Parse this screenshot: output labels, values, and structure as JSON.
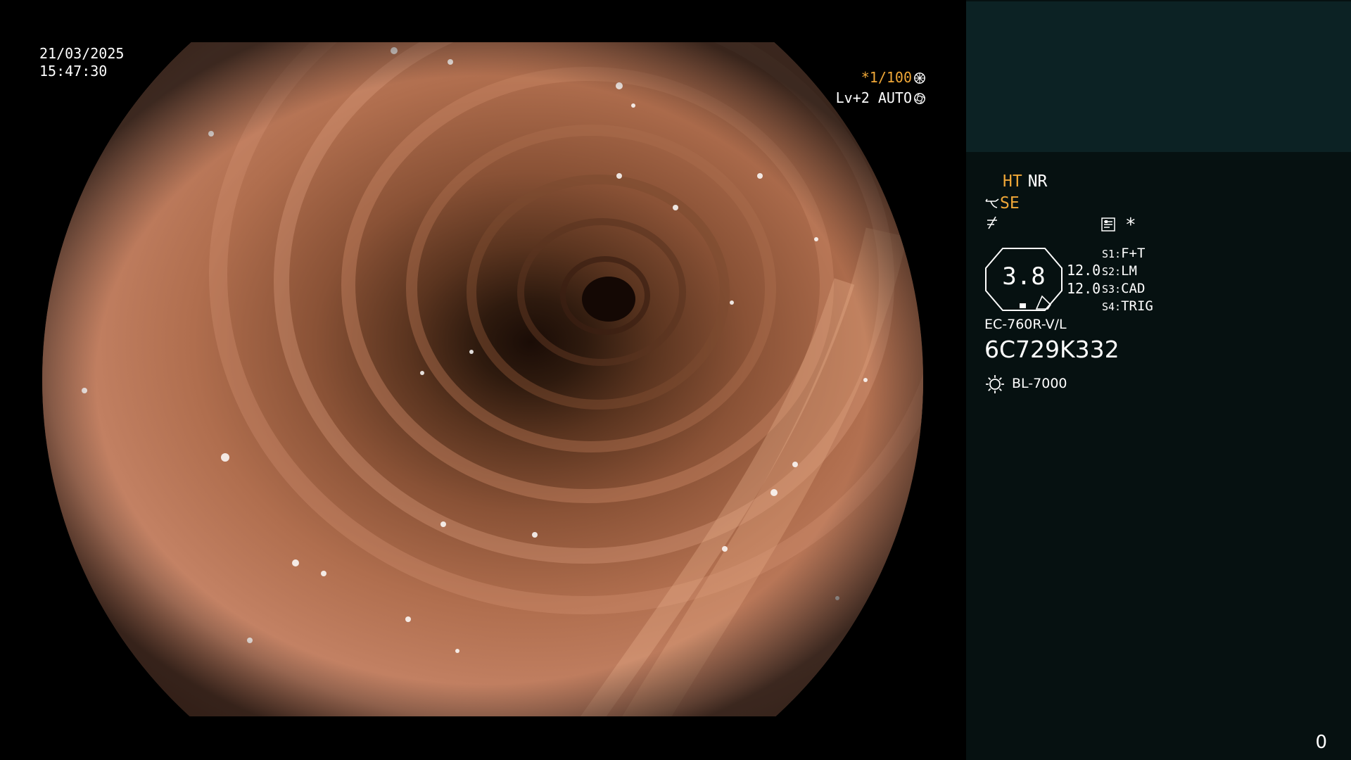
{
  "overlay": {
    "date": "21/03/2025",
    "time": "15:47:30",
    "shutter": "*1/100",
    "shutter_icon": "aperture-icon",
    "iris": "Lv+2 AUTO",
    "iris_icon": "iris-icon"
  },
  "panel": {
    "mode_ht": "HT",
    "mode_nr": "NR",
    "structure_icon": "structure-enhance-icon",
    "se": "SE",
    "sharpness_icon": "sharpness-icon",
    "memo_icon": "memo-icon",
    "asterisk": "*",
    "zoom": "3.8",
    "value_a": "12.0",
    "value_b": "12.0",
    "switches": [
      {
        "key": "S1:",
        "fn": "F+T"
      },
      {
        "key": "S2:",
        "fn": "LM"
      },
      {
        "key": "S3:",
        "fn": "CAD"
      },
      {
        "key": "S4:",
        "fn": "TRIG"
      }
    ],
    "scope_model": "EC-760R-V/L",
    "serial": "6C729K332",
    "light_icon": "light-source-icon",
    "light_source": "BL-7000",
    "counter": "0"
  },
  "colors": {
    "accent_orange": "#f0a838",
    "panel_bg": "#061111",
    "panel_top_bg": "#0c2224"
  }
}
